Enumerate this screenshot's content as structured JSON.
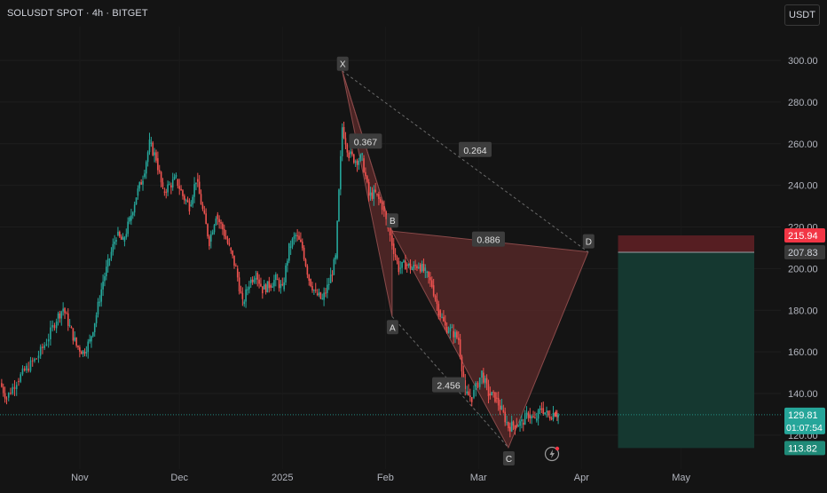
{
  "header": {
    "title": "SOLUSDT SPOT · 4h · BITGET",
    "currency_button": "USDT"
  },
  "colors": {
    "background": "#141414",
    "up": "#26a69a",
    "down": "#ef5350",
    "pattern_fill": "#5c2a2a",
    "stop_zone": "#5a1f23",
    "target_zone": "#153a32"
  },
  "chart_data": {
    "type": "line",
    "title": "",
    "ylim": [
      112,
      318
    ],
    "y_ticks": [
      120,
      140,
      160,
      180,
      200,
      220,
      240,
      260,
      280,
      300
    ],
    "y_tick_labels": [
      "120.00",
      "140.00",
      "160.00",
      "180.00",
      "200.00",
      "220.00",
      "240.00",
      "260.00",
      "280.00",
      "300.00"
    ],
    "x_ticks": [
      {
        "label": "Nov",
        "date": "2024-11-01"
      },
      {
        "label": "Dec",
        "date": "2024-12-01"
      },
      {
        "label": "2025",
        "date": "2025-01-01"
      },
      {
        "label": "Feb",
        "date": "2025-02-01"
      },
      {
        "label": "Mar",
        "date": "2025-03-01"
      },
      {
        "label": "Apr",
        "date": "2025-04-01"
      },
      {
        "label": "May",
        "date": "2025-05-01"
      }
    ],
    "xlim": [
      "2024-10-08",
      "2025-05-31"
    ],
    "series": [
      {
        "points": [
          [
            "2024-10-08",
            145
          ],
          [
            "2024-10-10",
            138
          ],
          [
            "2024-10-13",
            146
          ],
          [
            "2024-10-16",
            152
          ],
          [
            "2024-10-19",
            157
          ],
          [
            "2024-10-22",
            165
          ],
          [
            "2024-10-25",
            176
          ],
          [
            "2024-10-27",
            181
          ],
          [
            "2024-10-29",
            172
          ],
          [
            "2024-10-31",
            163
          ],
          [
            "2024-11-02",
            160
          ],
          [
            "2024-11-04",
            165
          ],
          [
            "2024-11-06",
            178
          ],
          [
            "2024-11-08",
            194
          ],
          [
            "2024-11-10",
            205
          ],
          [
            "2024-11-12",
            216
          ],
          [
            "2024-11-14",
            213
          ],
          [
            "2024-11-16",
            223
          ],
          [
            "2024-11-18",
            235
          ],
          [
            "2024-11-20",
            244
          ],
          [
            "2024-11-22",
            260
          ],
          [
            "2024-11-24",
            253
          ],
          [
            "2024-11-26",
            237
          ],
          [
            "2024-11-28",
            240
          ],
          [
            "2024-11-30",
            243
          ],
          [
            "2024-12-02",
            235
          ],
          [
            "2024-12-04",
            230
          ],
          [
            "2024-12-06",
            243
          ],
          [
            "2024-12-08",
            228
          ],
          [
            "2024-12-10",
            213
          ],
          [
            "2024-12-12",
            226
          ],
          [
            "2024-12-14",
            219
          ],
          [
            "2024-12-16",
            210
          ],
          [
            "2024-12-18",
            200
          ],
          [
            "2024-12-20",
            183
          ],
          [
            "2024-12-22",
            193
          ],
          [
            "2024-12-24",
            198
          ],
          [
            "2024-12-26",
            190
          ],
          [
            "2024-12-28",
            192
          ],
          [
            "2024-12-30",
            195
          ],
          [
            "2025-01-01",
            190
          ],
          [
            "2025-01-03",
            210
          ],
          [
            "2025-01-05",
            216
          ],
          [
            "2025-01-07",
            210
          ],
          [
            "2025-01-09",
            195
          ],
          [
            "2025-01-11",
            188
          ],
          [
            "2025-01-13",
            185
          ],
          [
            "2025-01-15",
            193
          ],
          [
            "2025-01-17",
            205
          ],
          [
            "2025-01-19",
            268
          ],
          [
            "2025-01-21",
            255
          ],
          [
            "2025-01-23",
            252
          ],
          [
            "2025-01-25",
            253
          ],
          [
            "2025-01-27",
            235
          ],
          [
            "2025-01-29",
            236
          ],
          [
            "2025-01-31",
            230
          ],
          [
            "2025-02-03",
            212
          ],
          [
            "2025-02-05",
            200
          ],
          [
            "2025-02-07",
            202
          ],
          [
            "2025-02-09",
            200
          ],
          [
            "2025-02-11",
            202
          ],
          [
            "2025-02-13",
            198
          ],
          [
            "2025-02-15",
            192
          ],
          [
            "2025-02-17",
            180
          ],
          [
            "2025-02-19",
            172
          ],
          [
            "2025-02-21",
            170
          ],
          [
            "2025-02-23",
            166
          ],
          [
            "2025-02-25",
            140
          ],
          [
            "2025-02-27",
            138
          ],
          [
            "2025-03-02",
            150
          ],
          [
            "2025-03-04",
            140
          ],
          [
            "2025-03-06",
            138
          ],
          [
            "2025-03-08",
            132
          ],
          [
            "2025-03-10",
            124
          ],
          [
            "2025-03-12",
            125
          ],
          [
            "2025-03-14",
            126
          ],
          [
            "2025-03-16",
            130
          ],
          [
            "2025-03-18",
            127
          ],
          [
            "2025-03-20",
            133
          ],
          [
            "2025-03-22",
            129
          ],
          [
            "2025-03-24",
            131
          ],
          [
            "2025-03-25",
            129.81
          ]
        ]
      }
    ],
    "pattern": {
      "points": [
        {
          "label": "X",
          "date": "2025-01-19",
          "value": 295
        },
        {
          "label": "A",
          "date": "2025-02-03",
          "value": 177
        },
        {
          "label": "B",
          "date": "2025-02-03",
          "value": 218
        },
        {
          "label": "C",
          "date": "2025-03-10",
          "value": 114
        },
        {
          "label": "D",
          "date": "2025-04-03",
          "value": 208
        }
      ],
      "ratios": [
        {
          "text": "0.367",
          "date": "2025-01-26",
          "value": 261
        },
        {
          "text": "0.264",
          "date": "2025-02-28",
          "value": 257
        },
        {
          "text": "0.886",
          "date": "2025-03-04",
          "value": 214
        },
        {
          "text": "2.456",
          "date": "2025-02-20",
          "value": 144
        }
      ]
    },
    "position": {
      "start": "2025-04-12",
      "end": "2025-05-31",
      "stop": 215.94,
      "entry": 207.83,
      "target": 113.82
    },
    "price_labels": [
      {
        "text": "215.94",
        "value": 215.94,
        "bg": "#f23645",
        "fg": "#ffffff"
      },
      {
        "text": "207.83",
        "value": 207.83,
        "bg": "#3a3a3a",
        "fg": "#d1d4dc"
      },
      {
        "text": "129.81",
        "subtext": "01:07:54",
        "value": 129.81,
        "bg": "#26a69a",
        "fg": "#ffffff"
      },
      {
        "text": "113.82",
        "value": 113.82,
        "bg": "#1f8a78",
        "fg": "#ffffff"
      }
    ],
    "current_price": 129.81
  }
}
